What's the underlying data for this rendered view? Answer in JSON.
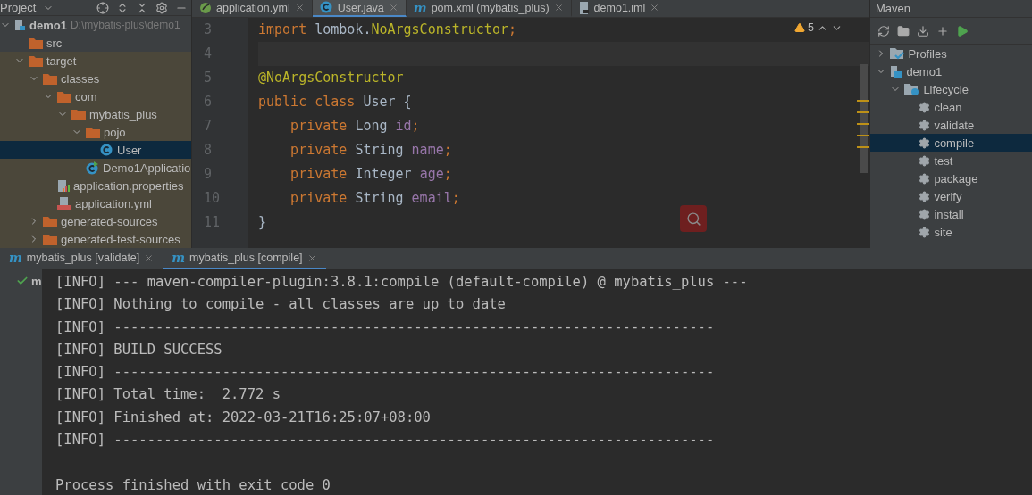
{
  "project_panel": {
    "title": "Project",
    "tree": [
      {
        "label": "demo1",
        "path": "D:\\mybatis-plus\\demo1",
        "kind": "module",
        "expanded": true,
        "excluded": false,
        "selected": false,
        "children": [
          {
            "label": "src",
            "kind": "folder",
            "excluded": false,
            "selected": false
          },
          {
            "label": "target",
            "kind": "folder",
            "expanded": true,
            "excluded": true,
            "selected": false,
            "children": [
              {
                "label": "classes",
                "kind": "folder",
                "expanded": true,
                "excluded": true,
                "selected": false,
                "children": [
                  {
                    "label": "com",
                    "kind": "folder",
                    "expanded": true,
                    "excluded": true,
                    "selected": false,
                    "children": [
                      {
                        "label": "mybatis_plus",
                        "kind": "folder",
                        "expanded": true,
                        "excluded": true,
                        "selected": false,
                        "children": [
                          {
                            "label": "pojo",
                            "kind": "folder",
                            "expanded": true,
                            "excluded": true,
                            "selected": false,
                            "children": [
                              {
                                "label": "User",
                                "kind": "class",
                                "excluded": true,
                                "selected": true
                              }
                            ]
                          },
                          {
                            "label": "Demo1Applicatio",
                            "kind": "app-class",
                            "excluded": true,
                            "selected": false
                          }
                        ]
                      }
                    ]
                  },
                  {
                    "label": "application.properties",
                    "kind": "properties",
                    "excluded": true,
                    "selected": false
                  },
                  {
                    "label": "application.yml",
                    "kind": "yml",
                    "excluded": true,
                    "selected": false
                  }
                ]
              },
              {
                "label": "generated-sources",
                "kind": "folder",
                "expanded": false,
                "excluded": true,
                "selected": false
              },
              {
                "label": "generated-test-sources",
                "kind": "folder",
                "expanded": false,
                "excluded": true,
                "selected": false
              }
            ]
          }
        ]
      }
    ]
  },
  "editor": {
    "tabs": [
      {
        "label": "application.yml",
        "kind": "spring",
        "selected": false
      },
      {
        "label": "User.java",
        "kind": "class",
        "selected": true
      },
      {
        "label": "pom.xml (mybatis_plus)",
        "kind": "maven",
        "icon": "m",
        "selected": false
      },
      {
        "label": "demo1.iml",
        "kind": "file",
        "selected": false
      }
    ],
    "warning_count": "5",
    "lines": [
      {
        "number": "3",
        "tokens": [
          {
            "text": "import ",
            "kind": "keyword"
          },
          {
            "text": "lombok.",
            "kind": "plain"
          },
          {
            "text": "NoArgsConstructor",
            "kind": "annotation"
          },
          {
            "text": ";",
            "kind": "keyword"
          }
        ]
      },
      {
        "number": "4"
      },
      {
        "number": "5",
        "tokens": [
          {
            "text": "@NoArgsConstructor",
            "kind": "annotation"
          }
        ]
      },
      {
        "number": "6",
        "tokens": [
          {
            "text": "public class ",
            "kind": "keyword"
          },
          {
            "text": "User {",
            "kind": "plain"
          }
        ]
      },
      {
        "number": "7",
        "tokens": [
          {
            "text": "    private ",
            "kind": "keyword"
          },
          {
            "text": "Long ",
            "kind": "plain"
          },
          {
            "text": "id",
            "kind": "field"
          },
          {
            "text": ";",
            "kind": "keyword"
          }
        ]
      },
      {
        "number": "8",
        "tokens": [
          {
            "text": "    private ",
            "kind": "keyword"
          },
          {
            "text": "String ",
            "kind": "plain"
          },
          {
            "text": "name",
            "kind": "field"
          },
          {
            "text": ";",
            "kind": "keyword"
          }
        ]
      },
      {
        "number": "9",
        "tokens": [
          {
            "text": "    private ",
            "kind": "keyword"
          },
          {
            "text": "Integer ",
            "kind": "plain"
          },
          {
            "text": "age",
            "kind": "field"
          },
          {
            "text": ";",
            "kind": "keyword"
          }
        ]
      },
      {
        "number": "10",
        "tokens": [
          {
            "text": "    private ",
            "kind": "keyword"
          },
          {
            "text": "String ",
            "kind": "plain"
          },
          {
            "text": "email",
            "kind": "field"
          },
          {
            "text": ";",
            "kind": "keyword"
          }
        ]
      },
      {
        "number": "11",
        "tokens": [
          {
            "text": "}",
            "kind": "plain"
          }
        ]
      }
    ]
  },
  "maven_panel": {
    "title": "Maven",
    "tree": [
      {
        "label": "Profiles",
        "kind": "profiles",
        "expanded": false,
        "selected": false
      },
      {
        "label": "demo1",
        "kind": "module",
        "expanded": true,
        "selected": false,
        "children": [
          {
            "label": "Lifecycle",
            "kind": "lifecycle",
            "expanded": true,
            "selected": false,
            "children": [
              {
                "label": "clean",
                "kind": "goal",
                "selected": false
              },
              {
                "label": "validate",
                "kind": "goal",
                "selected": false
              },
              {
                "label": "compile",
                "kind": "goal",
                "selected": true
              },
              {
                "label": "test",
                "kind": "goal",
                "selected": false
              },
              {
                "label": "package",
                "kind": "goal",
                "selected": false
              },
              {
                "label": "verify",
                "kind": "goal",
                "selected": false
              },
              {
                "label": "install",
                "kind": "goal",
                "selected": false
              },
              {
                "label": "site",
                "kind": "goal",
                "selected": false
              }
            ]
          }
        ]
      }
    ]
  },
  "run_panel": {
    "tabs": [
      {
        "icon": "m",
        "label": "mybatis_plus [validate]",
        "selected": false
      },
      {
        "icon": "m",
        "label": "mybatis_plus [compile]",
        "selected": true
      }
    ],
    "run_item": "m",
    "console": [
      {
        "kind": "text",
        "text": "[INFO] --- maven-compiler-plugin:3.8.1:compile (default-compile) @ mybatis_plus ---"
      },
      {
        "kind": "text",
        "text": "[INFO] Nothing to compile - all classes are up to date"
      },
      {
        "kind": "text",
        "text": "[INFO] ------------------------------------------------------------------------"
      },
      {
        "kind": "text",
        "text": "[INFO] BUILD SUCCESS"
      },
      {
        "kind": "text",
        "text": "[INFO] ------------------------------------------------------------------------"
      },
      {
        "kind": "text",
        "text": "[INFO] Total time:  2.772 s"
      },
      {
        "kind": "text",
        "text": "[INFO] Finished at: 2022-03-21T16:25:07+08:00"
      },
      {
        "kind": "text",
        "text": "[INFO] ------------------------------------------------------------------------"
      },
      {
        "kind": "blank"
      },
      {
        "kind": "text",
        "text": "Process finished with exit code 0"
      }
    ]
  }
}
